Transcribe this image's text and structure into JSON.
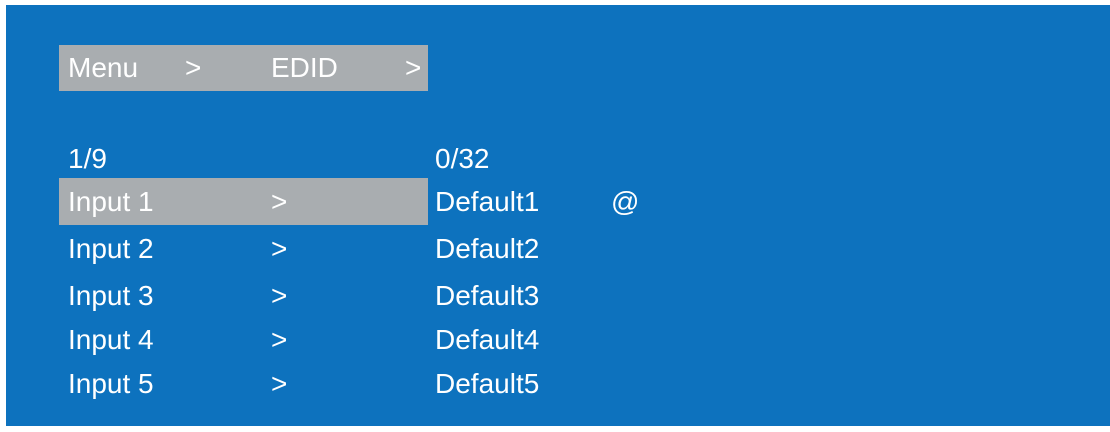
{
  "colors": {
    "background": "#0d72be",
    "highlight": "#a9adb0",
    "text": "#ffffff"
  },
  "breadcrumb": {
    "items": [
      {
        "label": "Menu",
        "separator": ">"
      },
      {
        "label": "EDID",
        "separator": ">"
      }
    ]
  },
  "page_counter": "1/9",
  "edid_counter": "0/32",
  "rows": [
    {
      "input": "Input 1",
      "arrow": ">",
      "edid": "Default1",
      "mark": "@",
      "selected": true
    },
    {
      "input": "Input 2",
      "arrow": ">",
      "edid": "Default2",
      "mark": "",
      "selected": false
    },
    {
      "input": "Input 3",
      "arrow": ">",
      "edid": "Default3",
      "mark": "",
      "selected": false
    },
    {
      "input": "Input 4",
      "arrow": ">",
      "edid": "Default4",
      "mark": "",
      "selected": false
    },
    {
      "input": "Input 5",
      "arrow": ">",
      "edid": "Default5",
      "mark": "",
      "selected": false
    }
  ]
}
